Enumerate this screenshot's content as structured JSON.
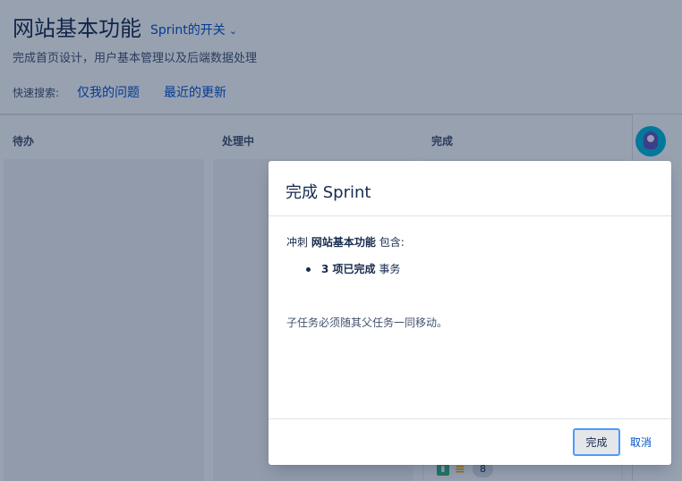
{
  "colors": {
    "primary_text": "#172b4d",
    "link": "#0052cc",
    "overlay": "rgba(9,30,66,0.42)",
    "focus_ring": "#4c9aff",
    "done_bookmark": "#36b37e"
  },
  "header": {
    "title": "网站基本功能",
    "sprint_switch": "Sprint的开关",
    "subtitle": "完成首页设计，用户基本管理以及后端数据处理",
    "quick_filters_label": "快速搜索:",
    "quick_filters": [
      "仅我的问题",
      "最近的更新"
    ]
  },
  "board": {
    "columns": [
      "待办",
      "处理中",
      "完成"
    ],
    "card": {
      "story_points": "8"
    }
  },
  "modal": {
    "title": "完成 Sprint",
    "sprint_prefix": "冲刺",
    "sprint_name": "网站基本功能",
    "sprint_suffix": "包含:",
    "summary": {
      "count_text": "3 项已完成",
      "unit": "事务"
    },
    "note": "子任务必须随其父任务一同移动。",
    "done_button": "完成",
    "cancel_button": "取消"
  }
}
